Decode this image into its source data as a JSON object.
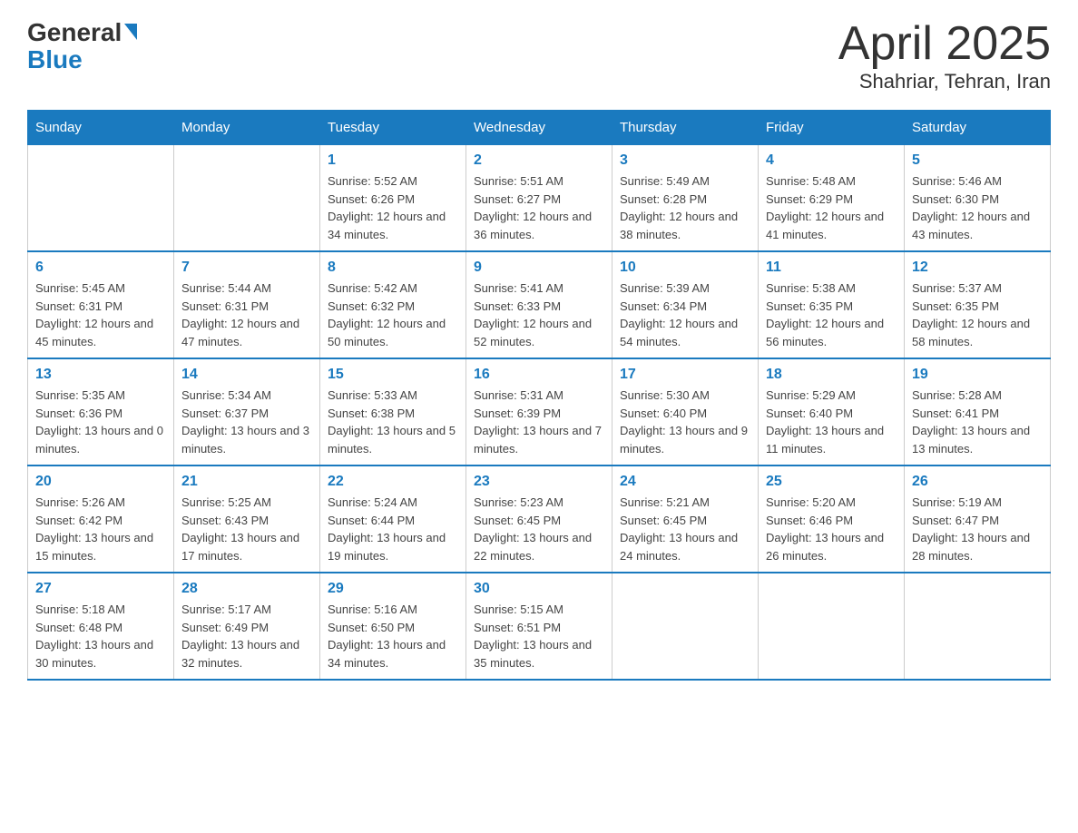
{
  "logo": {
    "general": "General",
    "blue": "Blue"
  },
  "title": "April 2025",
  "subtitle": "Shahriar, Tehran, Iran",
  "days_of_week": [
    "Sunday",
    "Monday",
    "Tuesday",
    "Wednesday",
    "Thursday",
    "Friday",
    "Saturday"
  ],
  "weeks": [
    [
      {
        "day": "",
        "sunrise": "",
        "sunset": "",
        "daylight": ""
      },
      {
        "day": "",
        "sunrise": "",
        "sunset": "",
        "daylight": ""
      },
      {
        "day": "1",
        "sunrise": "Sunrise: 5:52 AM",
        "sunset": "Sunset: 6:26 PM",
        "daylight": "Daylight: 12 hours and 34 minutes."
      },
      {
        "day": "2",
        "sunrise": "Sunrise: 5:51 AM",
        "sunset": "Sunset: 6:27 PM",
        "daylight": "Daylight: 12 hours and 36 minutes."
      },
      {
        "day": "3",
        "sunrise": "Sunrise: 5:49 AM",
        "sunset": "Sunset: 6:28 PM",
        "daylight": "Daylight: 12 hours and 38 minutes."
      },
      {
        "day": "4",
        "sunrise": "Sunrise: 5:48 AM",
        "sunset": "Sunset: 6:29 PM",
        "daylight": "Daylight: 12 hours and 41 minutes."
      },
      {
        "day": "5",
        "sunrise": "Sunrise: 5:46 AM",
        "sunset": "Sunset: 6:30 PM",
        "daylight": "Daylight: 12 hours and 43 minutes."
      }
    ],
    [
      {
        "day": "6",
        "sunrise": "Sunrise: 5:45 AM",
        "sunset": "Sunset: 6:31 PM",
        "daylight": "Daylight: 12 hours and 45 minutes."
      },
      {
        "day": "7",
        "sunrise": "Sunrise: 5:44 AM",
        "sunset": "Sunset: 6:31 PM",
        "daylight": "Daylight: 12 hours and 47 minutes."
      },
      {
        "day": "8",
        "sunrise": "Sunrise: 5:42 AM",
        "sunset": "Sunset: 6:32 PM",
        "daylight": "Daylight: 12 hours and 50 minutes."
      },
      {
        "day": "9",
        "sunrise": "Sunrise: 5:41 AM",
        "sunset": "Sunset: 6:33 PM",
        "daylight": "Daylight: 12 hours and 52 minutes."
      },
      {
        "day": "10",
        "sunrise": "Sunrise: 5:39 AM",
        "sunset": "Sunset: 6:34 PM",
        "daylight": "Daylight: 12 hours and 54 minutes."
      },
      {
        "day": "11",
        "sunrise": "Sunrise: 5:38 AM",
        "sunset": "Sunset: 6:35 PM",
        "daylight": "Daylight: 12 hours and 56 minutes."
      },
      {
        "day": "12",
        "sunrise": "Sunrise: 5:37 AM",
        "sunset": "Sunset: 6:35 PM",
        "daylight": "Daylight: 12 hours and 58 minutes."
      }
    ],
    [
      {
        "day": "13",
        "sunrise": "Sunrise: 5:35 AM",
        "sunset": "Sunset: 6:36 PM",
        "daylight": "Daylight: 13 hours and 0 minutes."
      },
      {
        "day": "14",
        "sunrise": "Sunrise: 5:34 AM",
        "sunset": "Sunset: 6:37 PM",
        "daylight": "Daylight: 13 hours and 3 minutes."
      },
      {
        "day": "15",
        "sunrise": "Sunrise: 5:33 AM",
        "sunset": "Sunset: 6:38 PM",
        "daylight": "Daylight: 13 hours and 5 minutes."
      },
      {
        "day": "16",
        "sunrise": "Sunrise: 5:31 AM",
        "sunset": "Sunset: 6:39 PM",
        "daylight": "Daylight: 13 hours and 7 minutes."
      },
      {
        "day": "17",
        "sunrise": "Sunrise: 5:30 AM",
        "sunset": "Sunset: 6:40 PM",
        "daylight": "Daylight: 13 hours and 9 minutes."
      },
      {
        "day": "18",
        "sunrise": "Sunrise: 5:29 AM",
        "sunset": "Sunset: 6:40 PM",
        "daylight": "Daylight: 13 hours and 11 minutes."
      },
      {
        "day": "19",
        "sunrise": "Sunrise: 5:28 AM",
        "sunset": "Sunset: 6:41 PM",
        "daylight": "Daylight: 13 hours and 13 minutes."
      }
    ],
    [
      {
        "day": "20",
        "sunrise": "Sunrise: 5:26 AM",
        "sunset": "Sunset: 6:42 PM",
        "daylight": "Daylight: 13 hours and 15 minutes."
      },
      {
        "day": "21",
        "sunrise": "Sunrise: 5:25 AM",
        "sunset": "Sunset: 6:43 PM",
        "daylight": "Daylight: 13 hours and 17 minutes."
      },
      {
        "day": "22",
        "sunrise": "Sunrise: 5:24 AM",
        "sunset": "Sunset: 6:44 PM",
        "daylight": "Daylight: 13 hours and 19 minutes."
      },
      {
        "day": "23",
        "sunrise": "Sunrise: 5:23 AM",
        "sunset": "Sunset: 6:45 PM",
        "daylight": "Daylight: 13 hours and 22 minutes."
      },
      {
        "day": "24",
        "sunrise": "Sunrise: 5:21 AM",
        "sunset": "Sunset: 6:45 PM",
        "daylight": "Daylight: 13 hours and 24 minutes."
      },
      {
        "day": "25",
        "sunrise": "Sunrise: 5:20 AM",
        "sunset": "Sunset: 6:46 PM",
        "daylight": "Daylight: 13 hours and 26 minutes."
      },
      {
        "day": "26",
        "sunrise": "Sunrise: 5:19 AM",
        "sunset": "Sunset: 6:47 PM",
        "daylight": "Daylight: 13 hours and 28 minutes."
      }
    ],
    [
      {
        "day": "27",
        "sunrise": "Sunrise: 5:18 AM",
        "sunset": "Sunset: 6:48 PM",
        "daylight": "Daylight: 13 hours and 30 minutes."
      },
      {
        "day": "28",
        "sunrise": "Sunrise: 5:17 AM",
        "sunset": "Sunset: 6:49 PM",
        "daylight": "Daylight: 13 hours and 32 minutes."
      },
      {
        "day": "29",
        "sunrise": "Sunrise: 5:16 AM",
        "sunset": "Sunset: 6:50 PM",
        "daylight": "Daylight: 13 hours and 34 minutes."
      },
      {
        "day": "30",
        "sunrise": "Sunrise: 5:15 AM",
        "sunset": "Sunset: 6:51 PM",
        "daylight": "Daylight: 13 hours and 35 minutes."
      },
      {
        "day": "",
        "sunrise": "",
        "sunset": "",
        "daylight": ""
      },
      {
        "day": "",
        "sunrise": "",
        "sunset": "",
        "daylight": ""
      },
      {
        "day": "",
        "sunrise": "",
        "sunset": "",
        "daylight": ""
      }
    ]
  ]
}
